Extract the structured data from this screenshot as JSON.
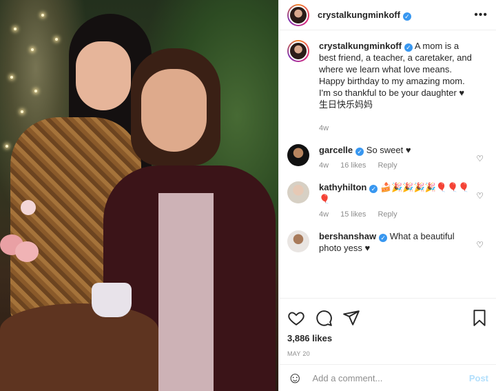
{
  "post": {
    "author": "crystalkungminkoff",
    "verified": true,
    "caption": "A mom is a best friend, a teacher, a caretaker, and where we learn what love means. Happy birthday to my amazing mom. I'm so thankful to be your daughter ♥ 生日快乐妈妈",
    "caption_age": "4w"
  },
  "comments": [
    {
      "user": "garcelle",
      "text": "So sweet ♥",
      "age": "4w",
      "likes": "16 likes",
      "reply": "Reply"
    },
    {
      "user": "kathyhilton",
      "text": "🍰🎉🎉🎉🎉🎈🎈🎈🎈",
      "age": "4w",
      "likes": "15 likes",
      "reply": "Reply"
    },
    {
      "user": "bershanshaw",
      "text": "What a beautiful photo yess ♥",
      "age": "",
      "likes": "",
      "reply": ""
    }
  ],
  "actions": {
    "likes": "3,886 likes",
    "date": "MAY 20"
  },
  "add_comment": {
    "placeholder": "Add a comment...",
    "post_label": "Post"
  },
  "icons": [
    "ellipsis-icon",
    "heart-icon",
    "comment-icon",
    "share-icon",
    "bookmark-icon",
    "emoji-icon",
    "verified-icon"
  ],
  "colors": {
    "verified": "#3897f0",
    "heart_red": "#ed4956",
    "post_link": "#b2dffc",
    "muted": "#8e8e8e"
  }
}
